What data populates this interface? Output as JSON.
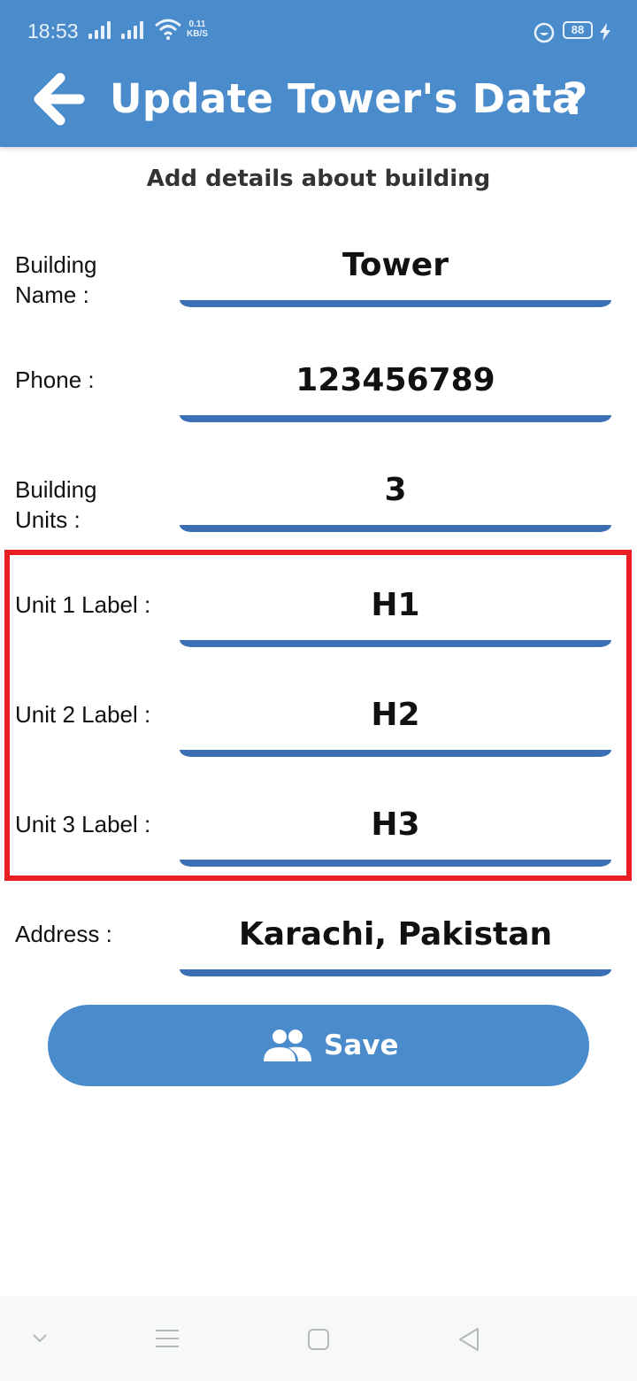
{
  "status_bar": {
    "time": "18:53",
    "speed_value": "0.11",
    "speed_unit": "KB/S",
    "battery": "88"
  },
  "app_bar": {
    "title": "Update Tower's Data",
    "help_label": "?"
  },
  "form": {
    "subtitle": "Add details about building",
    "building_name": {
      "label_line1": "Building",
      "label_line2": "Name :",
      "value": "Tower"
    },
    "phone": {
      "label": "Phone :",
      "value": "123456789"
    },
    "building_units": {
      "label_line1": "Building",
      "label_line2": "Units :",
      "value": "3"
    },
    "units": [
      {
        "label": "Unit 1 Label :",
        "value": "H1"
      },
      {
        "label": "Unit 2 Label :",
        "value": "H2"
      },
      {
        "label": "Unit 3 Label :",
        "value": "H3"
      }
    ],
    "address": {
      "label": "Address :",
      "value": "Karachi, Pakistan"
    },
    "save_label": "Save"
  },
  "colors": {
    "primary": "#4a8bcc",
    "underline": "#3a6eb5",
    "highlight": "#ec1c24"
  },
  "icons": [
    "back-arrow-icon",
    "help-icon",
    "group-icon",
    "signal-icon",
    "wifi-icon",
    "battery-icon",
    "nav-down-icon",
    "nav-menu-icon",
    "nav-home-icon",
    "nav-back-icon"
  ]
}
